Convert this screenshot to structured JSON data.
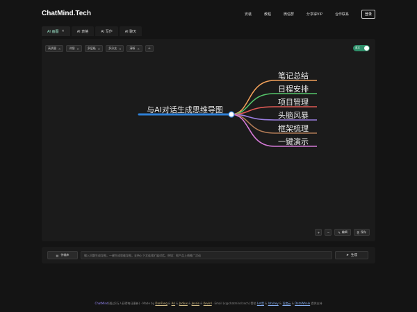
{
  "header": {
    "brand": "ChatMind.Tech",
    "nav": [
      "安装",
      "教程",
      "微信群",
      "分享得VIP",
      "合作联系"
    ],
    "login": "登录"
  },
  "tabs": [
    {
      "label": "AI 画图",
      "active": true
    },
    {
      "label": "AI 表格"
    },
    {
      "label": "AI 写作"
    },
    {
      "label": "AI 聊天"
    }
  ],
  "chips": [
    "高质量",
    "详细",
    "多层级",
    "多分支",
    "清晰"
  ],
  "chip_add": "+",
  "toggle_label": "英文",
  "mindmap": {
    "root": "与AI对话生成思维导图",
    "branches": [
      {
        "label": "笔记总结",
        "color": "#f0a05a"
      },
      {
        "label": "日程安排",
        "color": "#55c46a"
      },
      {
        "label": "项目管理",
        "color": "#e05a55"
      },
      {
        "label": "头脑风暴",
        "color": "#9a7ee0"
      },
      {
        "label": "框架梳理",
        "color": "#b07a55"
      },
      {
        "label": "一键演示",
        "color": "#d57ad8"
      }
    ],
    "root_color": "#2e7fd6"
  },
  "tools": {
    "zoom_in": "+",
    "zoom_out": "−",
    "edit": "编辑",
    "save": "保存"
  },
  "bottom": {
    "upload": "传输库",
    "placeholder": "输入问题生成导图，一键生成思维导图，支持上下文连续扩展对话，例如：帮产品上线推广活动",
    "generate": "生成"
  },
  "footer": {
    "lead": "ChatMind",
    "text1": "(通过3万人获得每日更新) · Made by ",
    "authors": [
      "DanFang",
      "Ari",
      "Jadiux",
      "Jessie",
      "Kevinl"
    ],
    "email": " · Email (x@chatmind.tech)",
    "text2": "   赞助 ",
    "sponsors": [
      "Let是",
      "Iatuhey",
      "百度云"
    ],
    "org": "DataWhale",
    "tail": " 提供支持"
  }
}
